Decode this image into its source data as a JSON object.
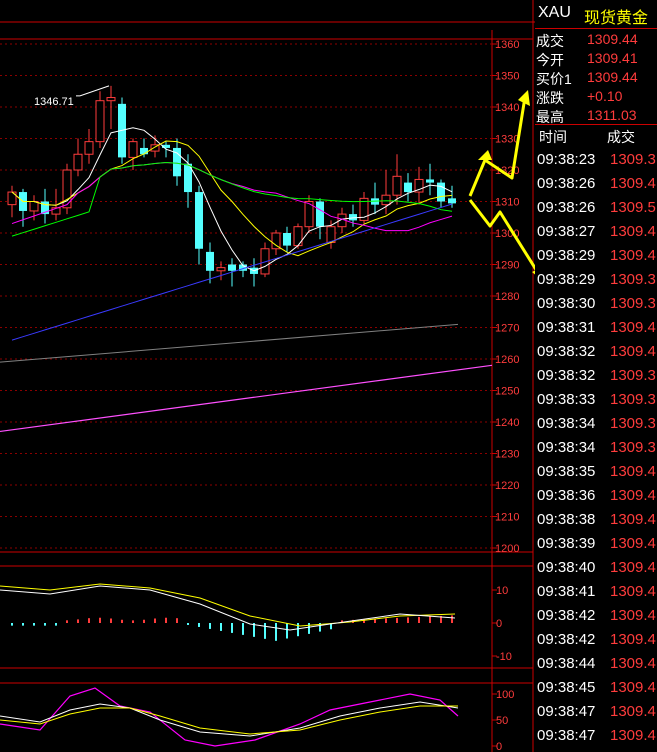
{
  "header": {
    "symbol": "XAU",
    "name": "现货黄金"
  },
  "quote": [
    {
      "label": "成交",
      "value": "1309.44"
    },
    {
      "label": "今开",
      "value": "1309.41"
    },
    {
      "label": "买价1",
      "value": "1309.44"
    },
    {
      "label": "涨跌",
      "value": "+0.10"
    },
    {
      "label": "最高",
      "value": "1311.03"
    }
  ],
  "ticks_header": {
    "time": "时间",
    "price": "成交"
  },
  "ticks": [
    {
      "time": "09:38:23",
      "price": "1309.3"
    },
    {
      "time": "09:38:26",
      "price": "1309.4"
    },
    {
      "time": "09:38:26",
      "price": "1309.5"
    },
    {
      "time": "09:38:27",
      "price": "1309.4"
    },
    {
      "time": "09:38:29",
      "price": "1309.4"
    },
    {
      "time": "09:38:29",
      "price": "1309.3"
    },
    {
      "time": "09:38:30",
      "price": "1309.3"
    },
    {
      "time": "09:38:31",
      "price": "1309.4"
    },
    {
      "time": "09:38:32",
      "price": "1309.4"
    },
    {
      "time": "09:38:32",
      "price": "1309.3"
    },
    {
      "time": "09:38:33",
      "price": "1309.3"
    },
    {
      "time": "09:38:34",
      "price": "1309.3"
    },
    {
      "time": "09:38:34",
      "price": "1309.3"
    },
    {
      "time": "09:38:35",
      "price": "1309.4"
    },
    {
      "time": "09:38:36",
      "price": "1309.4"
    },
    {
      "time": "09:38:38",
      "price": "1309.4"
    },
    {
      "time": "09:38:39",
      "price": "1309.4"
    },
    {
      "time": "09:38:40",
      "price": "1309.4"
    },
    {
      "time": "09:38:41",
      "price": "1309.4"
    },
    {
      "time": "09:38:42",
      "price": "1309.4"
    },
    {
      "time": "09:38:42",
      "price": "1309.4"
    },
    {
      "time": "09:38:44",
      "price": "1309.4"
    },
    {
      "time": "09:38:45",
      "price": "1309.4"
    },
    {
      "time": "09:38:47",
      "price": "1309.4"
    },
    {
      "time": "09:38:47",
      "price": "1309.4"
    }
  ],
  "colors": {
    "up": "#ff3c3c",
    "down": "#54ffff",
    "grid": "#8b0000",
    "ma5": "#ffffff",
    "ma10": "#ffff00",
    "ma20": "#ff00ff",
    "ma30": "#00ff00",
    "ma60": "#3a3aff",
    "ma120": "#808080",
    "ma250": "#ff50ff",
    "arrow": "#ffff00"
  },
  "chart_data": [
    {
      "type": "candlestick",
      "ylim": [
        1200,
        1360
      ],
      "ticks": [
        "1360",
        "1350",
        "1340",
        "1330",
        "1320",
        "1310",
        "1300",
        "1290",
        "1280",
        "1270",
        "1260",
        "1250",
        "1240",
        "1230",
        "1220",
        "1210",
        "1200"
      ],
      "annotation": {
        "text": "1346.71",
        "value": 1346.71
      },
      "candles": [
        {
          "o": 1309,
          "h": 1315,
          "l": 1305,
          "c": 1313
        },
        {
          "o": 1313,
          "h": 1314,
          "l": 1302,
          "c": 1307
        },
        {
          "o": 1307,
          "h": 1312,
          "l": 1304,
          "c": 1310
        },
        {
          "o": 1310,
          "h": 1314,
          "l": 1303,
          "c": 1306
        },
        {
          "o": 1306,
          "h": 1314,
          "l": 1304,
          "c": 1308
        },
        {
          "o": 1308,
          "h": 1322,
          "l": 1306,
          "c": 1320
        },
        {
          "o": 1320,
          "h": 1330,
          "l": 1318,
          "c": 1325
        },
        {
          "o": 1325,
          "h": 1333,
          "l": 1322,
          "c": 1329
        },
        {
          "o": 1329,
          "h": 1345,
          "l": 1327,
          "c": 1342
        },
        {
          "o": 1342,
          "h": 1346.71,
          "l": 1333,
          "c": 1343
        },
        {
          "o": 1341,
          "h": 1343,
          "l": 1322,
          "c": 1324
        },
        {
          "o": 1324,
          "h": 1330,
          "l": 1320,
          "c": 1329
        },
        {
          "o": 1327,
          "h": 1330,
          "l": 1324,
          "c": 1325
        },
        {
          "o": 1326,
          "h": 1331,
          "l": 1324,
          "c": 1328
        },
        {
          "o": 1328,
          "h": 1329,
          "l": 1324,
          "c": 1327
        },
        {
          "o": 1327,
          "h": 1330,
          "l": 1315,
          "c": 1318
        },
        {
          "o": 1322,
          "h": 1325,
          "l": 1308,
          "c": 1313
        },
        {
          "o": 1313,
          "h": 1315,
          "l": 1290,
          "c": 1295
        },
        {
          "o": 1294,
          "h": 1297,
          "l": 1284,
          "c": 1288
        },
        {
          "o": 1288,
          "h": 1291,
          "l": 1285,
          "c": 1289
        },
        {
          "o": 1290,
          "h": 1292,
          "l": 1283,
          "c": 1288
        },
        {
          "o": 1290,
          "h": 1291,
          "l": 1286,
          "c": 1288
        },
        {
          "o": 1289,
          "h": 1292,
          "l": 1283,
          "c": 1287
        },
        {
          "o": 1287,
          "h": 1297,
          "l": 1286,
          "c": 1295
        },
        {
          "o": 1295,
          "h": 1301,
          "l": 1293,
          "c": 1300
        },
        {
          "o": 1300,
          "h": 1302,
          "l": 1294,
          "c": 1296
        },
        {
          "o": 1296,
          "h": 1303,
          "l": 1295,
          "c": 1302
        },
        {
          "o": 1302,
          "h": 1312,
          "l": 1300,
          "c": 1310
        },
        {
          "o": 1310,
          "h": 1311,
          "l": 1298,
          "c": 1302
        },
        {
          "o": 1297,
          "h": 1304,
          "l": 1295,
          "c": 1302
        },
        {
          "o": 1302,
          "h": 1308,
          "l": 1300,
          "c": 1306
        },
        {
          "o": 1306,
          "h": 1309,
          "l": 1302,
          "c": 1304
        },
        {
          "o": 1304,
          "h": 1313,
          "l": 1303,
          "c": 1311
        },
        {
          "o": 1311,
          "h": 1316,
          "l": 1306,
          "c": 1309
        },
        {
          "o": 1309,
          "h": 1320,
          "l": 1306,
          "c": 1312
        },
        {
          "o": 1312,
          "h": 1325,
          "l": 1309,
          "c": 1318
        },
        {
          "o": 1316,
          "h": 1319,
          "l": 1310,
          "c": 1313
        },
        {
          "o": 1313,
          "h": 1321,
          "l": 1309,
          "c": 1317
        },
        {
          "o": 1317,
          "h": 1322,
          "l": 1312,
          "c": 1316
        },
        {
          "o": 1316,
          "h": 1317,
          "l": 1308,
          "c": 1310
        },
        {
          "o": 1311,
          "h": 1315,
          "l": 1308,
          "c": 1309.4
        }
      ]
    },
    {
      "type": "bar",
      "ylim": [
        -10,
        10
      ],
      "ticks": [
        "10",
        "0",
        "-10"
      ]
    },
    {
      "type": "line",
      "ylim": [
        0,
        100
      ],
      "ticks": [
        "100",
        "50",
        "0"
      ]
    }
  ]
}
